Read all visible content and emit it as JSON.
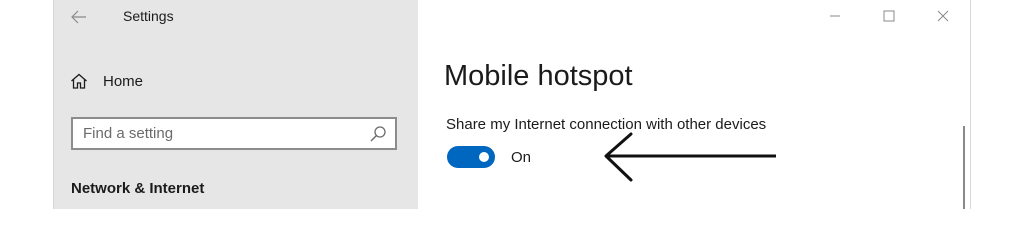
{
  "window": {
    "title": "Settings"
  },
  "sidebar": {
    "home_label": "Home",
    "search": {
      "placeholder": "Find a setting",
      "value": ""
    },
    "section_heading": "Network & Internet"
  },
  "main": {
    "page_title": "Mobile hotspot",
    "share_setting": {
      "label": "Share my Internet connection with other devices",
      "toggle_state": "On",
      "enabled": true
    }
  },
  "colors": {
    "accent": "#0067c0",
    "sidebar_bg": "#e6e6e6",
    "text": "#1b1b1b"
  },
  "icons": {
    "back": "back-arrow-icon",
    "minimize": "minimize-icon",
    "maximize": "maximize-icon",
    "close": "close-icon",
    "home": "home-icon",
    "search": "search-icon",
    "annotation": "annotation-arrow-icon"
  }
}
